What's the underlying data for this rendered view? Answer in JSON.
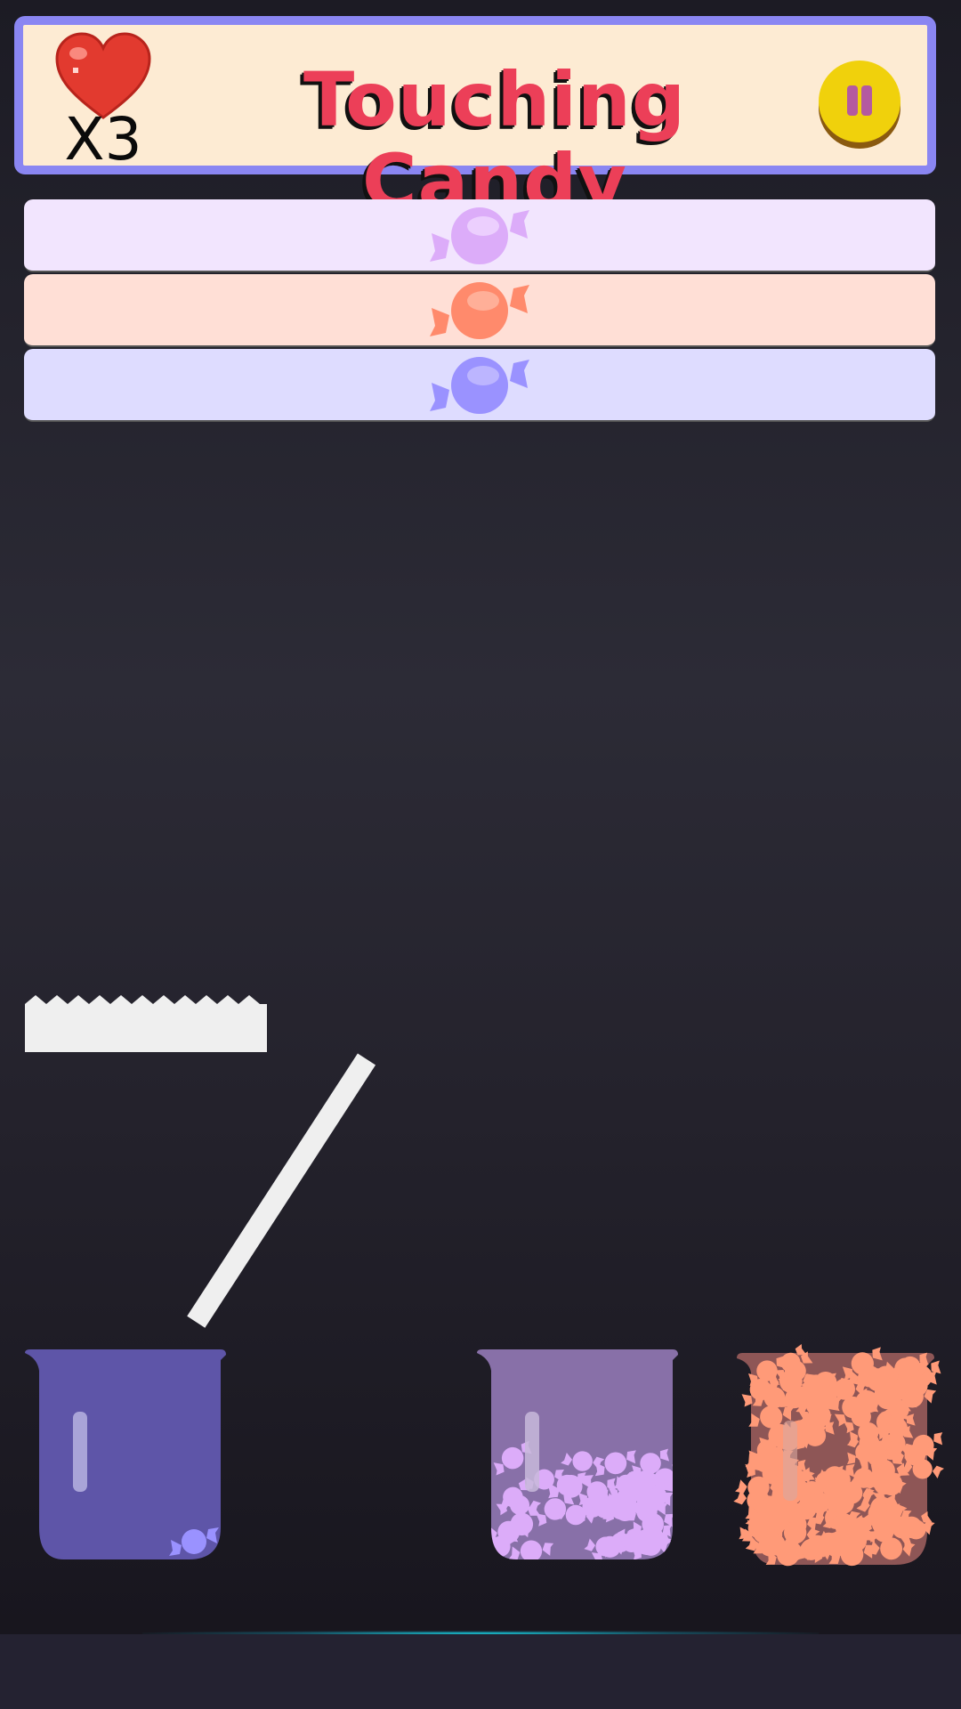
{
  "header": {
    "title": "Touching Candy",
    "lives_text": "X3",
    "lives_icon": "heart-icon",
    "pause_icon": "pause-icon"
  },
  "candy_strips": [
    {
      "name": "lilac",
      "bg": "#f2e5fe",
      "candy": "#dcacf9"
    },
    {
      "name": "coral",
      "bg": "#ffdfd6",
      "candy": "#ff8a6c"
    },
    {
      "name": "blue",
      "bg": "#dedcff",
      "candy": "#9a92ff"
    }
  ],
  "cups": [
    {
      "name": "left",
      "fill": "#5e55a8",
      "candy_count": 1
    },
    {
      "name": "middle",
      "fill": "#8870a8",
      "candy_count": 40
    },
    {
      "name": "right",
      "fill": "#8e5656",
      "candy_count": 120
    }
  ],
  "colors": {
    "header_border": "#8a86f2",
    "header_bg": "#fdebd3",
    "title": "#ec3f58",
    "pause": "#f0d10c"
  }
}
